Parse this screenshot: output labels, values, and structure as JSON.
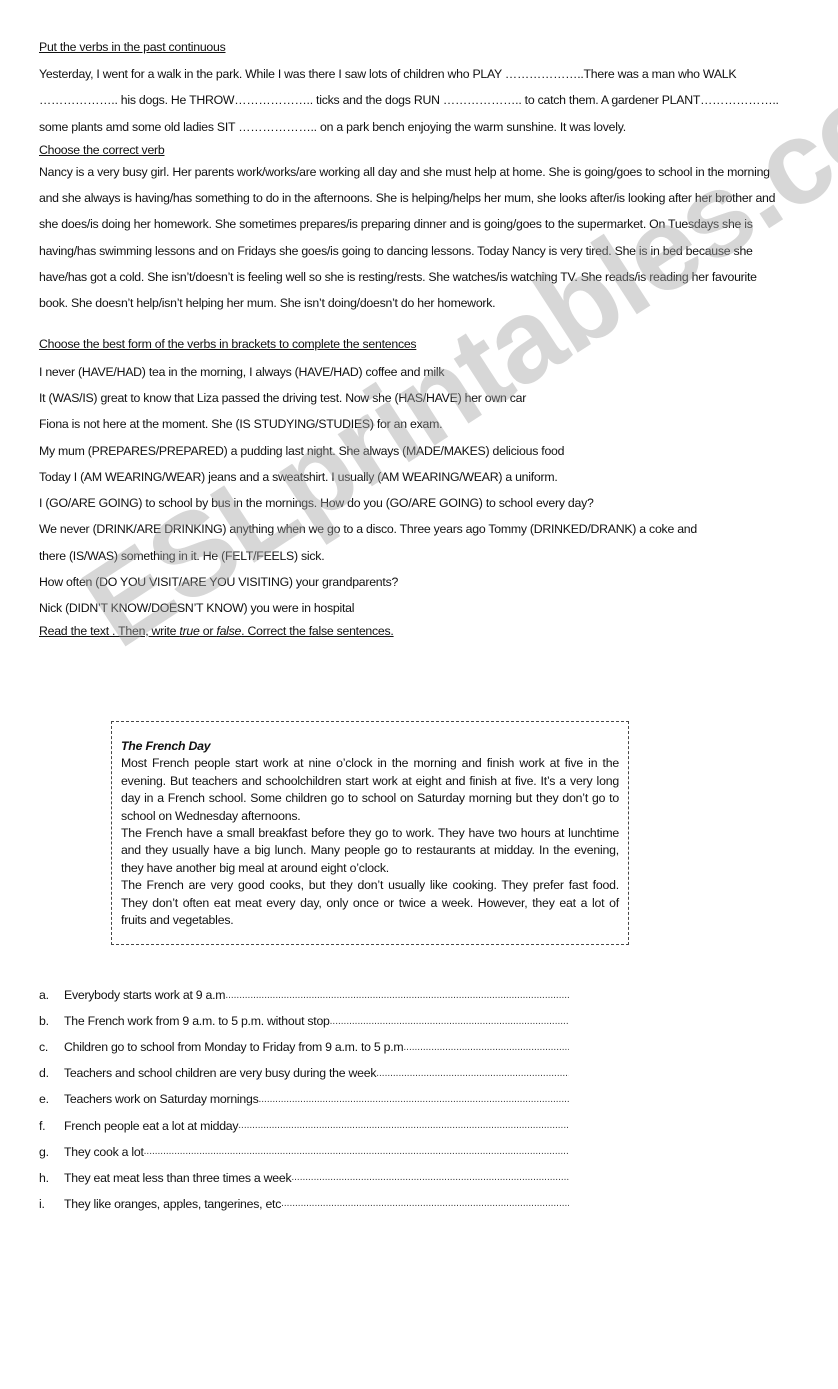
{
  "section1": {
    "heading": "Put the verbs in the past continuous",
    "text": "Yesterday, I went for a walk in the park. While I was there I saw lots of children who PLAY ………………..There was a man who WALK ……………….. his dogs. He THROW……………….. ticks and the dogs RUN ……………….. to catch them. A gardener PLANT……………….. some plants amd some old ladies SIT ……………….. on a park bench enjoying the warm sunshine. It was lovely."
  },
  "section2": {
    "heading": "Choose the correct verb",
    "text": "Nancy is a very busy girl. Her parents work/works/are working all day and she must help at home. She is going/goes to school in the morning and she always is having/has something to do in the afternoons. She is helping/helps her mum, she looks after/is looking after her brother and she does/is doing her homework. She sometimes prepares/is preparing dinner and is going/goes to the supermarket. On Tuesdays she is having/has swimming lessons and on Fridays she goes/is going to dancing lessons. Today Nancy is very tired. She is in bed because she have/has got a cold. She isn’t/doesn’t is feeling well so she is resting/rests. She watches/is watching TV. She reads/is reading her favourite book. She doesn’t help/isn’t helping her mum. She isn’t doing/doesn’t do her homework."
  },
  "section3": {
    "heading": "Choose the best form of the verbs in brackets to complete the sentences",
    "sentences": [
      "I never (HAVE/HAD) tea in the morning, I always (HAVE/HAD) coffee and milk",
      "It (WAS/IS) great to know that Liza passed the driving test. Now she (HAS/HAVE) her own car",
      "Fiona is not here at the moment. She (IS STUDYING/STUDIES) for an exam.",
      "My mum (PREPARES/PREPARED) a pudding last night. She always (MADE/MAKES) delicious food",
      "Today I (AM WEARING/WEAR) jeans and a sweatshirt. I usually (AM WEARING/WEAR) a uniform.",
      "I (GO/ARE GOING) to school by bus in the mornings. How do you (GO/ARE GOING) to school every day?",
      "We never (DRINK/ARE DRINKING) anything when we go to a disco. Three years ago Tommy (DRINKED/DRANK) a coke and",
      "there (IS/WAS) something in it. He (FELT/FEELS) sick.",
      "How often (DO YOU VISIT/ARE YOU VISITING) your grandparents?",
      "Nick (DIDN’T KNOW/DOESN’T KNOW) you were in hospital"
    ]
  },
  "section4": {
    "heading_part1": "Read the text . Then, write ",
    "heading_true": "true",
    "heading_or": " or ",
    "heading_false": "false",
    "heading_part2": ". Correct the false sentences.",
    "box": {
      "title": "The French Day",
      "paragraphs": [
        "Most French people start work at nine o’clock in the morning and finish work at five in the evening. But teachers and schoolchildren start work at eight and finish at five. It’s a very long day in a French school. Some children go to school on Saturday morning but they don’t go to school on Wednesday afternoons.",
        "The French have a small breakfast before they go to work. They have two hours at lunchtime and  they usually have a big lunch. Many people go to restaurants at midday. In the evening, they have another big meal at around eight o’clock.",
        "The French are very good cooks, but they don’t usually like cooking. They prefer fast food. They don’t often eat meat every day, only once or twice a week. However, they eat a lot of fruits and vegetables."
      ]
    },
    "statements": [
      {
        "letter": "a.",
        "text": "Everybody starts work at 9 a.m"
      },
      {
        "letter": "b.",
        "text": "The French work from 9 a.m. to  5 p.m. without stop"
      },
      {
        "letter": "c.",
        "text": "Children go to school from Monday to Friday from 9 a.m. to 5 p.m"
      },
      {
        "letter": "d.",
        "text": "Teachers and school children are very busy during the week"
      },
      {
        "letter": "e.",
        "text": "Teachers work on Saturday mornings"
      },
      {
        "letter": "f.",
        "text": "French people eat a lot at midday"
      },
      {
        "letter": "g.",
        "text": "They cook a lot"
      },
      {
        "letter": "h.",
        "text": "They eat meat less than three times a week"
      },
      {
        "letter": "i.",
        "text": "They like oranges, apples, tangerines, etc"
      }
    ],
    "answer_dots": "........................................................................................................................................................................................................."
  },
  "watermark": "ESLprintables.com"
}
